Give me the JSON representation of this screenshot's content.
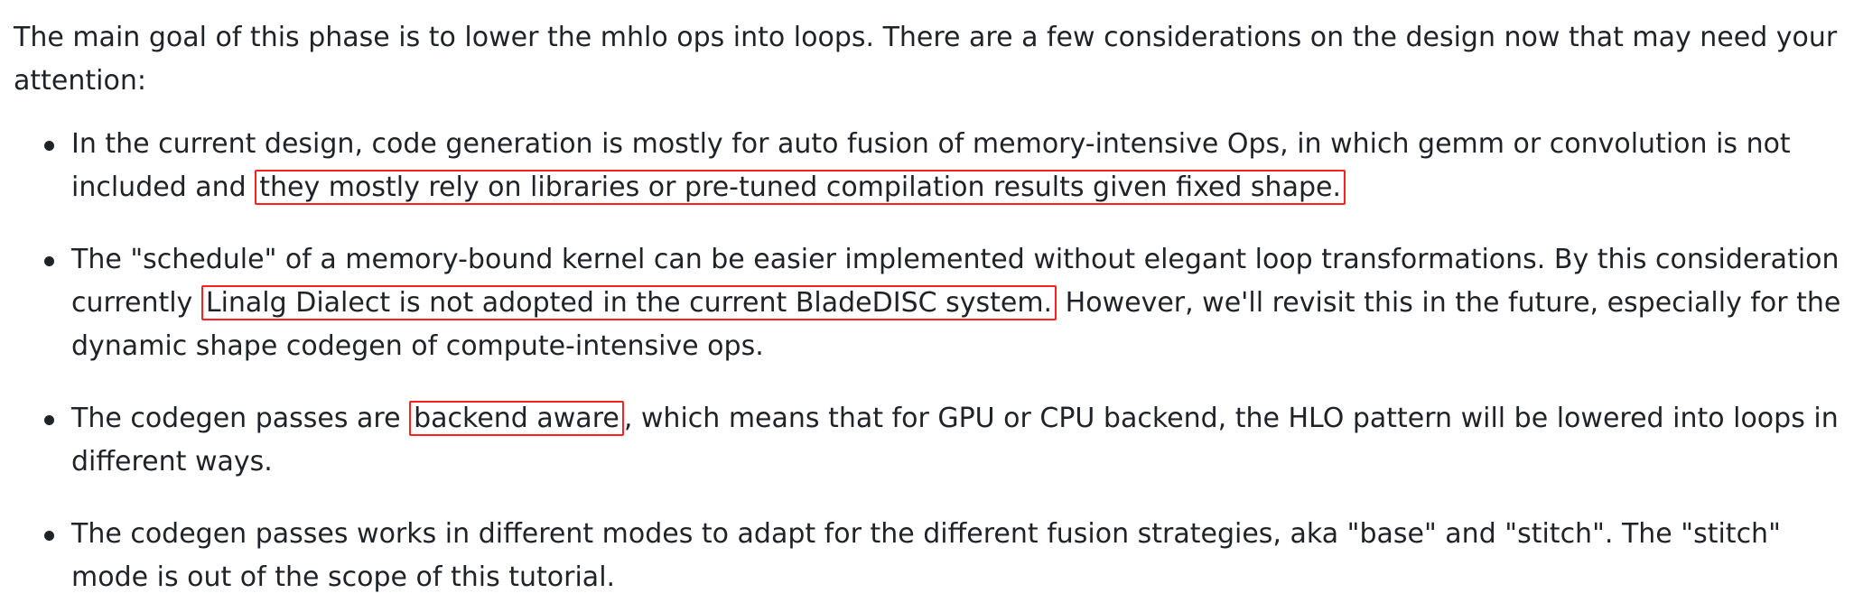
{
  "intro": "The main goal of this phase is to lower the mhlo ops into loops. There are a few considerations on the design now that may need your attention:",
  "bullets": [
    {
      "before": "In the current design, code generation is mostly for auto fusion of memory-intensive Ops, in which gemm or convolution is not included and",
      "highlight": "they mostly rely on libraries or pre-tuned compilation results given fixed shape.",
      "after": ""
    },
    {
      "before": "The \"schedule\" of a memory-bound kernel can be easier implemented without elegant loop transformations. By this consideration currently",
      "highlight": "Linalg Dialect is not adopted in the current BladeDISC system.",
      "after": "However, we'll revisit this in the future, especially for the dynamic shape codegen of compute-intensive ops."
    },
    {
      "before": "The codegen passes are",
      "highlight": "backend aware",
      "after": ", which means that for GPU or CPU backend, the HLO pattern will be lowered into loops in different ways."
    },
    {
      "before": "The codegen passes works in different modes to adapt for the different fusion strategies, aka \"base\" and \"stitch\". The \"stitch\" mode is out of the scope of this tutorial.",
      "highlight": "",
      "after": ""
    }
  ],
  "colors": {
    "text": "#1f2328",
    "highlight_border": "#ff1f1f",
    "background": "#ffffff"
  }
}
